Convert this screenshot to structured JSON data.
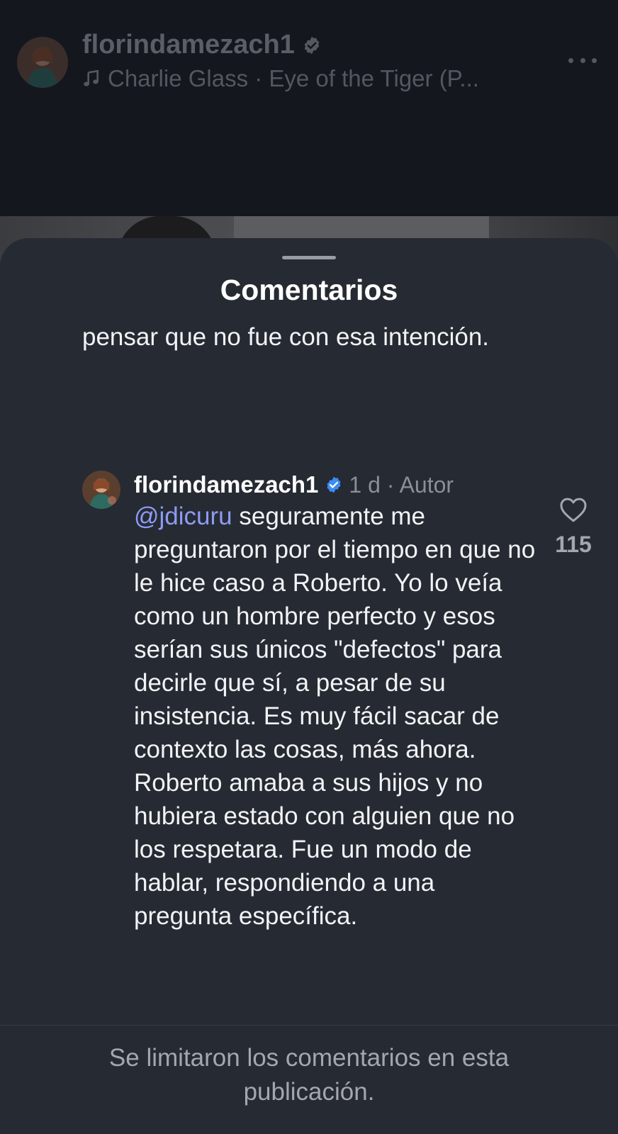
{
  "post_header": {
    "username": "florindamezach1",
    "verified_icon": "verified-badge-icon",
    "music_icon": "music-note-icon",
    "music_text": "Charlie Glass · Eye of the Tiger (P...",
    "more_icon": "more-horizontal-icon"
  },
  "sheet": {
    "title": "Comentarios",
    "previous_comment_tail": "pensar que no fue con esa intención."
  },
  "comment": {
    "username": "florindamezach1",
    "verified_icon": "verified-badge-icon",
    "meta": "1 d · Autor",
    "mention": "@jdicuru",
    "text": " seguramente me preguntaron por el tiempo en que no le hice caso a Roberto. Yo lo veía como un hombre perfecto y esos serían sus únicos \"defectos\" para decirle que sí, a pesar de su insistencia. Es muy fácil sacar de contexto las cosas, más ahora. Roberto amaba a sus hijos y no hubiera estado con alguien que no los respetara. Fue un modo de hablar, respondiendo a una pregunta específica.",
    "like_icon": "heart-outline-icon",
    "like_count": "115"
  },
  "footer": {
    "notice": "Se limitaron los comentarios en esta publicación."
  },
  "colors": {
    "sheet_background": "#262a33",
    "mention": "#8d9bf2",
    "verified_blue": "#3b8cf5"
  }
}
